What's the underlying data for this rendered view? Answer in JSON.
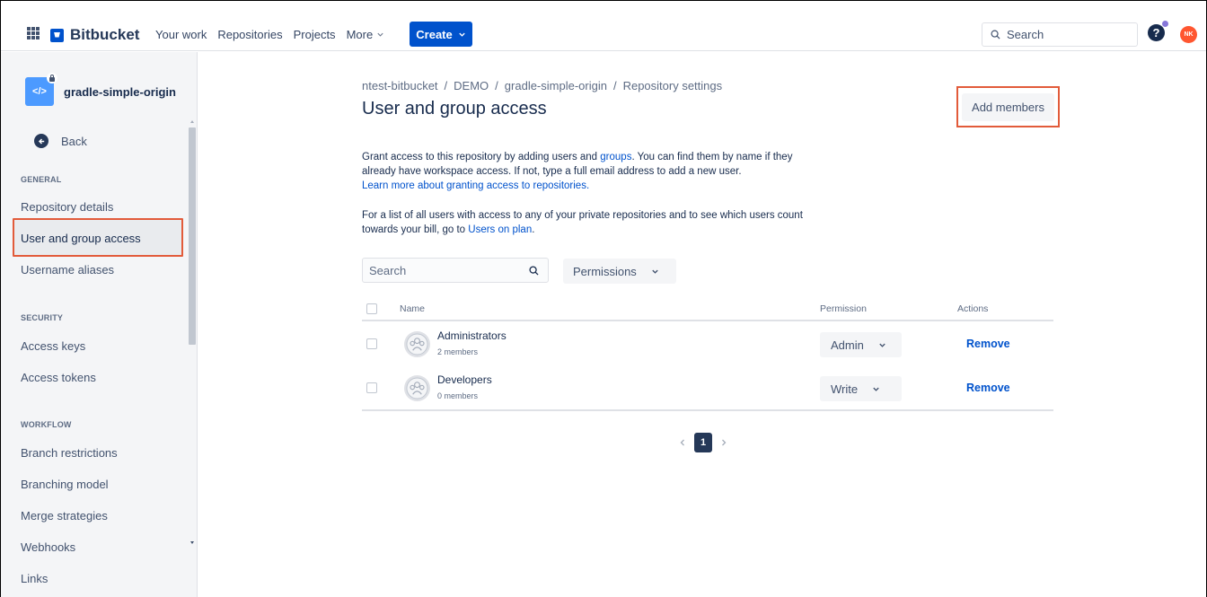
{
  "topnav": {
    "brand": "Bitbucket",
    "links": [
      "Your work",
      "Repositories",
      "Projects"
    ],
    "more_label": "More",
    "create_label": "Create",
    "search_placeholder": "Search",
    "help_glyph": "?",
    "avatar_initials": "NK"
  },
  "sidebar": {
    "repo_avatar_glyph": "</>",
    "repo_name": "gradle-simple-origin",
    "back_label": "Back",
    "sections": {
      "general": "GENERAL",
      "security": "SECURITY",
      "workflow": "WORKFLOW"
    },
    "items": {
      "repository_details": "Repository details",
      "user_group_access": "User and group access",
      "username_aliases": "Username aliases",
      "access_keys": "Access keys",
      "access_tokens": "Access tokens",
      "branch_restrictions": "Branch restrictions",
      "branching_model": "Branching model",
      "merge_strategies": "Merge strategies",
      "webhooks": "Webhooks",
      "links": "Links"
    }
  },
  "main": {
    "breadcrumb": [
      "ntest-bitbucket",
      "DEMO",
      "gradle-simple-origin",
      "Repository settings"
    ],
    "breadcrumb_sep": "/",
    "title": "User and group access",
    "add_members_label": "Add members",
    "desc1_pre": "Grant access to this repository by adding users and ",
    "desc1_link": "groups",
    "desc1_post": ". You can find them by name if they already have workspace access. If not, type a full email address to add a new user.",
    "desc1_learn": "Learn more about granting access to repositories.",
    "desc2_pre": "For a list of all users with access to any of your private repositories and to see which users count towards your bill, go to ",
    "desc2_link": "Users on plan",
    "desc2_post": ".",
    "filter_search_placeholder": "Search",
    "permissions_filter_label": "Permissions",
    "table": {
      "col_name": "Name",
      "col_permission": "Permission",
      "col_actions": "Actions",
      "rows": [
        {
          "name": "Administrators",
          "members": "2 members",
          "permission": "Admin",
          "action": "Remove"
        },
        {
          "name": "Developers",
          "members": "0 members",
          "permission": "Write",
          "action": "Remove"
        }
      ]
    },
    "pagination": {
      "current": "1"
    }
  },
  "colors": {
    "brand_blue": "#0052cc",
    "highlight_outline": "#e25b3a",
    "avatar_bg": "#ff5630"
  }
}
